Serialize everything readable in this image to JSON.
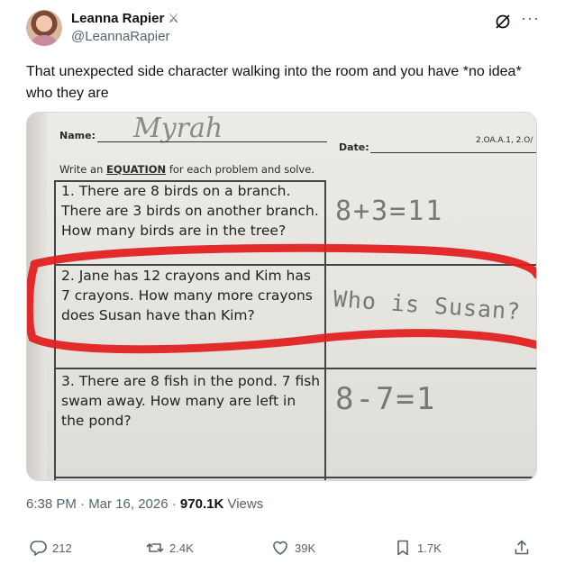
{
  "author": {
    "display_name": "Leanna Rapier",
    "badge_icon": "crossed-swords-icon",
    "handle": "@LeannaRapier"
  },
  "tweet": {
    "text": "That unexpected side character walking into the room and you have *no idea* who they are"
  },
  "media": {
    "worksheet": {
      "name_label": "Name:",
      "name_value": "Myrah",
      "date_label": "Date:",
      "code": "2.OA.A.1, 2.O/",
      "instruction_prefix": "Write an ",
      "instruction_keyword": "EQUATION",
      "instruction_suffix": " for each problem and solve.",
      "problems": [
        {
          "text": "1. There are 8 birds on a branch. There are 3 birds on another branch. How many birds are in the tree?",
          "answer": "8+3=11"
        },
        {
          "text": "2. Jane has 12 crayons and Kim has 7 crayons. How many more crayons does Susan have than Kim?",
          "answer": "Who is Susan?"
        },
        {
          "text": "3. There are 8 fish in the pond. 7 fish swam away. How many are left in the pond?",
          "answer": "8-7=1"
        }
      ]
    },
    "highlight_color": "#e21b1b"
  },
  "meta": {
    "time_date": "6:38 PM · Mar 16, 2026 · ",
    "views_count": "970.1K",
    "views_label": " Views"
  },
  "actions": {
    "replies": "212",
    "reposts": "2.4K",
    "likes": "39K",
    "bookmarks": "1.7K"
  },
  "colors": {
    "text_primary": "#0f1419",
    "text_secondary": "#536471"
  }
}
